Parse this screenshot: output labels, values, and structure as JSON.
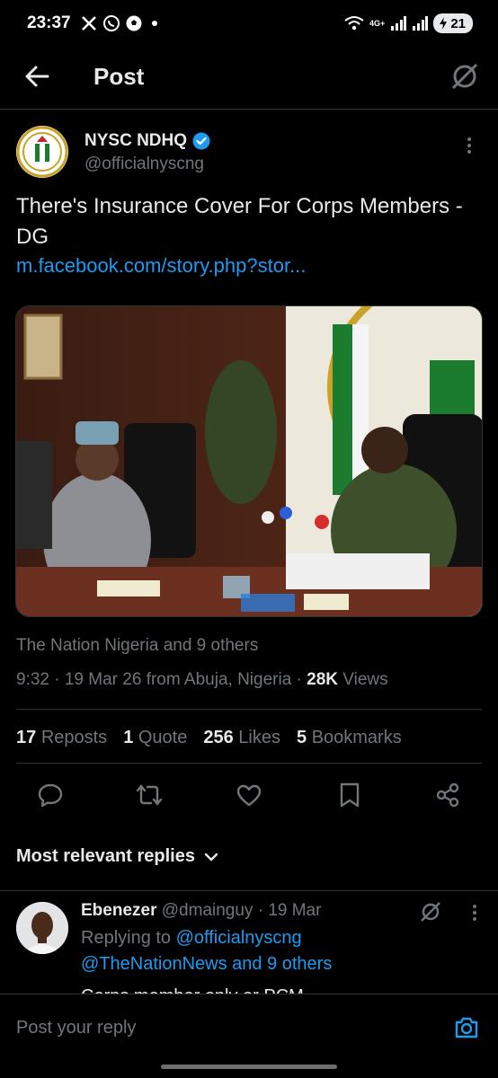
{
  "status_bar": {
    "time": "23:37",
    "network": "4G+",
    "battery": "21",
    "icons": [
      "x-app-icon",
      "whatsapp-icon",
      "football-icon",
      "wifi-icon",
      "signal-icon",
      "battery-icon"
    ]
  },
  "header": {
    "title": "Post",
    "back_icon": "arrow-left-icon",
    "grok_icon": "grok-icon"
  },
  "post": {
    "author_name": "NYSC NDHQ",
    "author_handle": "@officialnyscng",
    "verified": true,
    "text": "There's Insurance Cover For Corps Members -DG",
    "link": "m.facebook.com/story.php?stor...",
    "media_alt": "Photo",
    "reposted_by": "The Nation Nigeria and 9 others",
    "timestamp": "9:32 · 19 Mar 26 from Abuja, Nigeria · ",
    "views_count": "28K",
    "views_label": " Views"
  },
  "stats": {
    "reposts_count": "17",
    "reposts_label": "Reposts",
    "quotes_count": "1",
    "quotes_label": "Quote",
    "likes_count": "256",
    "likes_label": "Likes",
    "bookmarks_count": "5",
    "bookmarks_label": "Bookmarks"
  },
  "actions": [
    "reply-icon",
    "repost-icon",
    "like-icon",
    "bookmark-icon",
    "share-icon"
  ],
  "replies": {
    "sort_label": "Most relevant replies",
    "items": [
      {
        "name": "Ebenezer",
        "handle": "@dmainguy",
        "date": " · 19 Mar",
        "replying_prefix": "Replying to ",
        "replying_to_1": "@officialnyscng",
        "replying_to_2": "@TheNationNews and 9 others",
        "text": "Corps member only or PCM"
      }
    ]
  },
  "compose": {
    "placeholder": "Post your reply"
  },
  "colors": {
    "background": "#000000",
    "accent": "#1d9bf0",
    "muted": "#71767b",
    "text": "#e7e9ea",
    "divider": "#2f3336"
  }
}
